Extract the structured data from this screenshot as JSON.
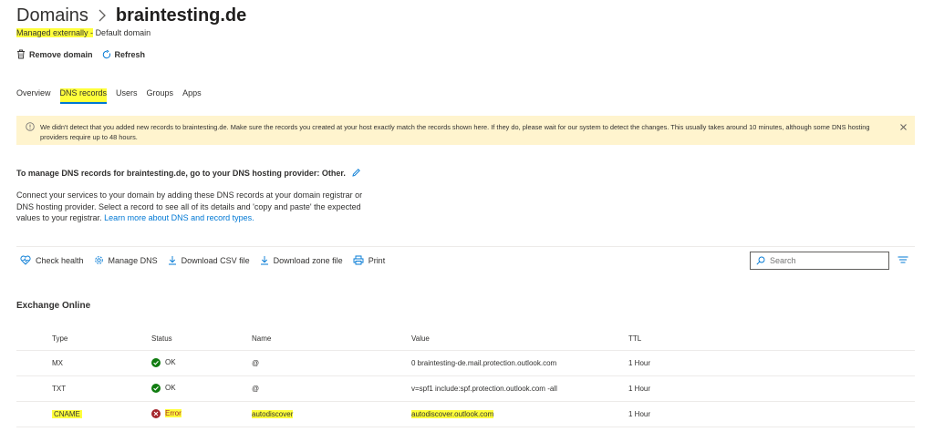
{
  "header": {
    "parent": "Domains",
    "domain": "braintesting.de",
    "subtitle_status": "Managed externally -",
    "subtitle_extra": "Default domain"
  },
  "actions": {
    "remove_label": "Remove domain",
    "refresh_label": "Refresh"
  },
  "tabs": [
    {
      "label": "Overview"
    },
    {
      "label": "DNS records"
    },
    {
      "label": "Users"
    },
    {
      "label": "Groups"
    },
    {
      "label": "Apps"
    }
  ],
  "banner": {
    "text": "We didn't detect that you added new records to braintesting.de. Make sure the records you created at your host exactly match the records shown here. If they do, please wait for our system to detect the changes. This usually takes around 10 minutes, although some DNS hosting providers require up to 48 hours."
  },
  "manage": {
    "title": "To manage DNS records for braintesting.de, go to your DNS hosting provider: Other.",
    "description": "Connect your services to your domain by adding these DNS records at your domain registrar or DNS hosting provider. Select a record to see all of its details and 'copy and paste' the expected values to your registrar.",
    "link": "Learn more about DNS and record types."
  },
  "toolbar": {
    "check_health": "Check health",
    "manage_dns": "Manage DNS",
    "download_csv": "Download CSV file",
    "download_zone": "Download zone file",
    "print": "Print",
    "search_placeholder": "Search"
  },
  "section": {
    "title": "Exchange Online"
  },
  "table": {
    "headers": {
      "type": "Type",
      "status": "Status",
      "name": "Name",
      "value": "Value",
      "ttl": "TTL"
    },
    "rows": [
      {
        "type": "MX",
        "status": "OK",
        "name": "@",
        "value": "0 braintesting-de.mail.protection.outlook.com",
        "ttl": "1 Hour"
      },
      {
        "type": "TXT",
        "status": "OK",
        "name": "@",
        "value": "v=spf1 include:spf.protection.outlook.com -all",
        "ttl": "1 Hour"
      },
      {
        "type": "CNAME",
        "status": "Error",
        "name": "autodiscover",
        "value": "autodiscover.outlook.com",
        "ttl": "1 Hour"
      }
    ]
  },
  "colors": {
    "accent": "#0078d4",
    "ok": "#107c10",
    "error": "#a4262c",
    "highlight": "#ffff3b",
    "banner_bg": "#fff4ce"
  }
}
